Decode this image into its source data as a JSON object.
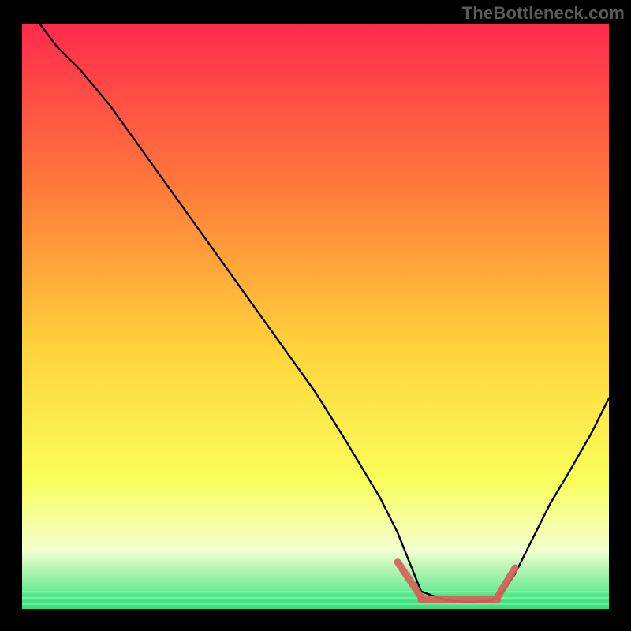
{
  "watermark": "TheBottleneck.com",
  "colors": {
    "black": "#000000",
    "watermark": "#5a5a5a",
    "curve": "#000000",
    "flat_marker": "#d9605a",
    "grad_top": "#ff2a4d",
    "grad_mid1": "#ff7a3a",
    "grad_mid2": "#ffd23a",
    "grad_mid3": "#f9ff5a",
    "grad_bottom_pale": "#f3ffd0",
    "grad_green": "#2fe27a"
  },
  "chart_data": {
    "type": "line",
    "title": "",
    "xlabel": "",
    "ylabel": "",
    "xlim": [
      0,
      100
    ],
    "ylim": [
      0,
      100
    ],
    "grid": false,
    "note": "Background is a vertical red→yellow→green gradient. A black bottleneck curve descends from top-left, reaches a flat minimum around x≈68–82, then rises toward the right edge. Pink overlay segments mark the short transition portions at the start and end of the flat minimum.",
    "series": [
      {
        "name": "bottleneck-curve",
        "x": [
          3,
          6,
          10,
          15,
          20,
          25,
          30,
          35,
          40,
          45,
          50,
          55,
          58,
          61,
          64,
          66,
          68,
          72,
          76,
          80,
          82,
          84,
          86,
          88,
          90,
          93,
          97,
          100
        ],
        "y": [
          100,
          96,
          92,
          86,
          79,
          72,
          65,
          58,
          51,
          44,
          37,
          29,
          24,
          19,
          13,
          8,
          3,
          1.5,
          1.2,
          1.4,
          3,
          6,
          10,
          14,
          18,
          23,
          30,
          36
        ]
      }
    ],
    "flat_region_x_range": [
      65,
      83
    ],
    "flat_region_y": 1.3,
    "marker_segments": [
      {
        "x0": 64,
        "y0": 8,
        "x1": 68,
        "y1": 2
      },
      {
        "x0": 68,
        "y0": 1.6,
        "x1": 81,
        "y1": 1.6
      },
      {
        "x0": 81,
        "y0": 2,
        "x1": 84,
        "y1": 7
      }
    ]
  }
}
